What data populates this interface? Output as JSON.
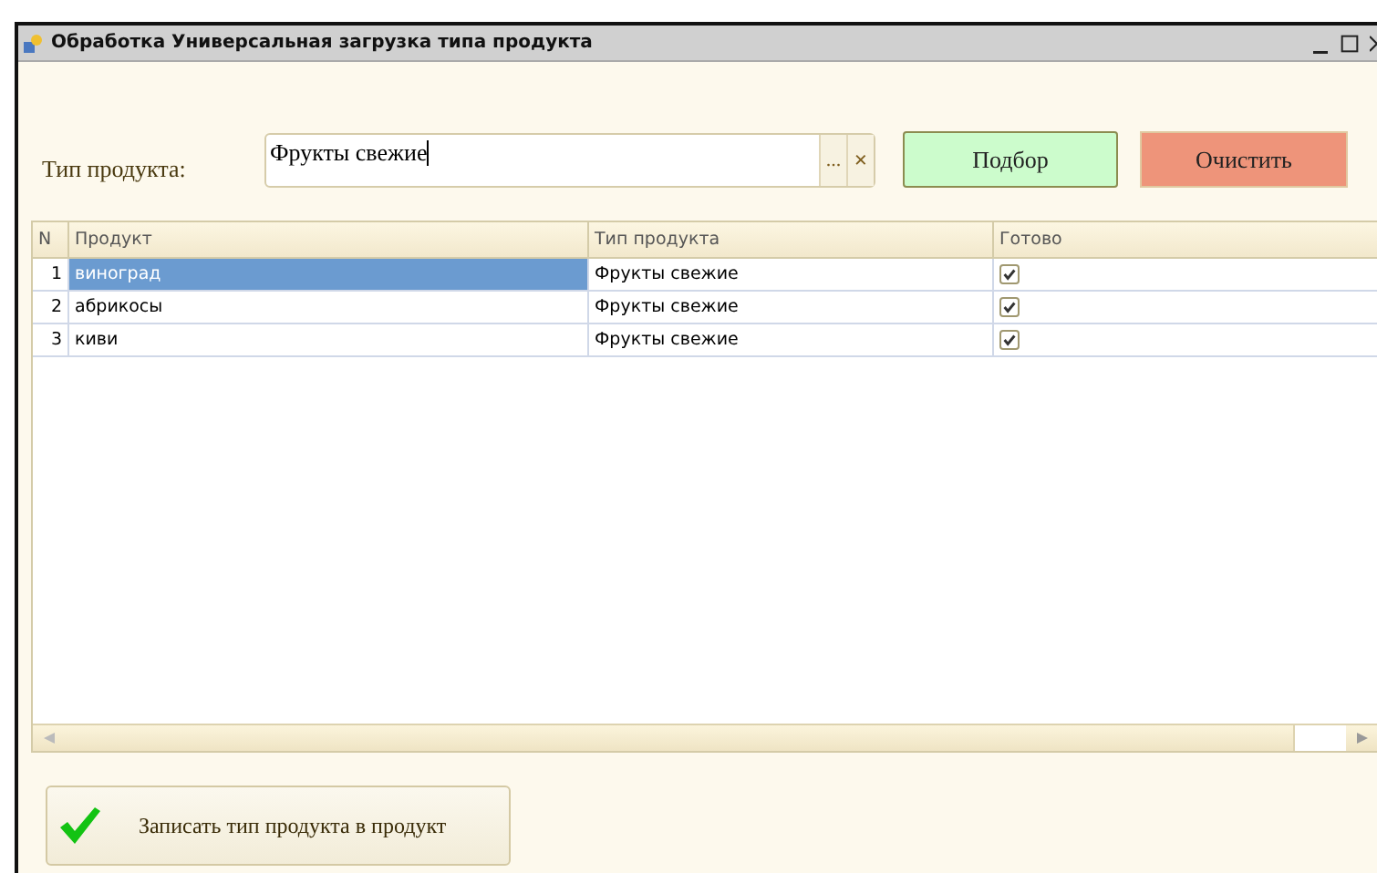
{
  "window": {
    "title": "Обработка  Универсальная загрузка типа продукта"
  },
  "form": {
    "label": "Тип продукта:",
    "field": {
      "value": "Фрукты свежие",
      "select_button": "...",
      "clear_button": "×"
    },
    "buttons": [
      {
        "label": "Подбор",
        "kind": "pick"
      },
      {
        "label": "Очистить",
        "kind": "clear"
      }
    ]
  },
  "table": {
    "columns": [
      "N",
      "Продукт",
      "Тип продукта",
      "Готово"
    ],
    "rows": [
      {
        "n": "1",
        "product": "виноград",
        "type": "Фрукты свежие",
        "done": true,
        "selected": true
      },
      {
        "n": "2",
        "product": "абрикосы",
        "type": "Фрукты свежие",
        "done": true,
        "selected": false
      },
      {
        "n": "3",
        "product": "киви",
        "type": "Фрукты свежие",
        "done": true,
        "selected": false
      }
    ]
  },
  "action_button": {
    "label": "Записать тип продукта в продукт"
  }
}
